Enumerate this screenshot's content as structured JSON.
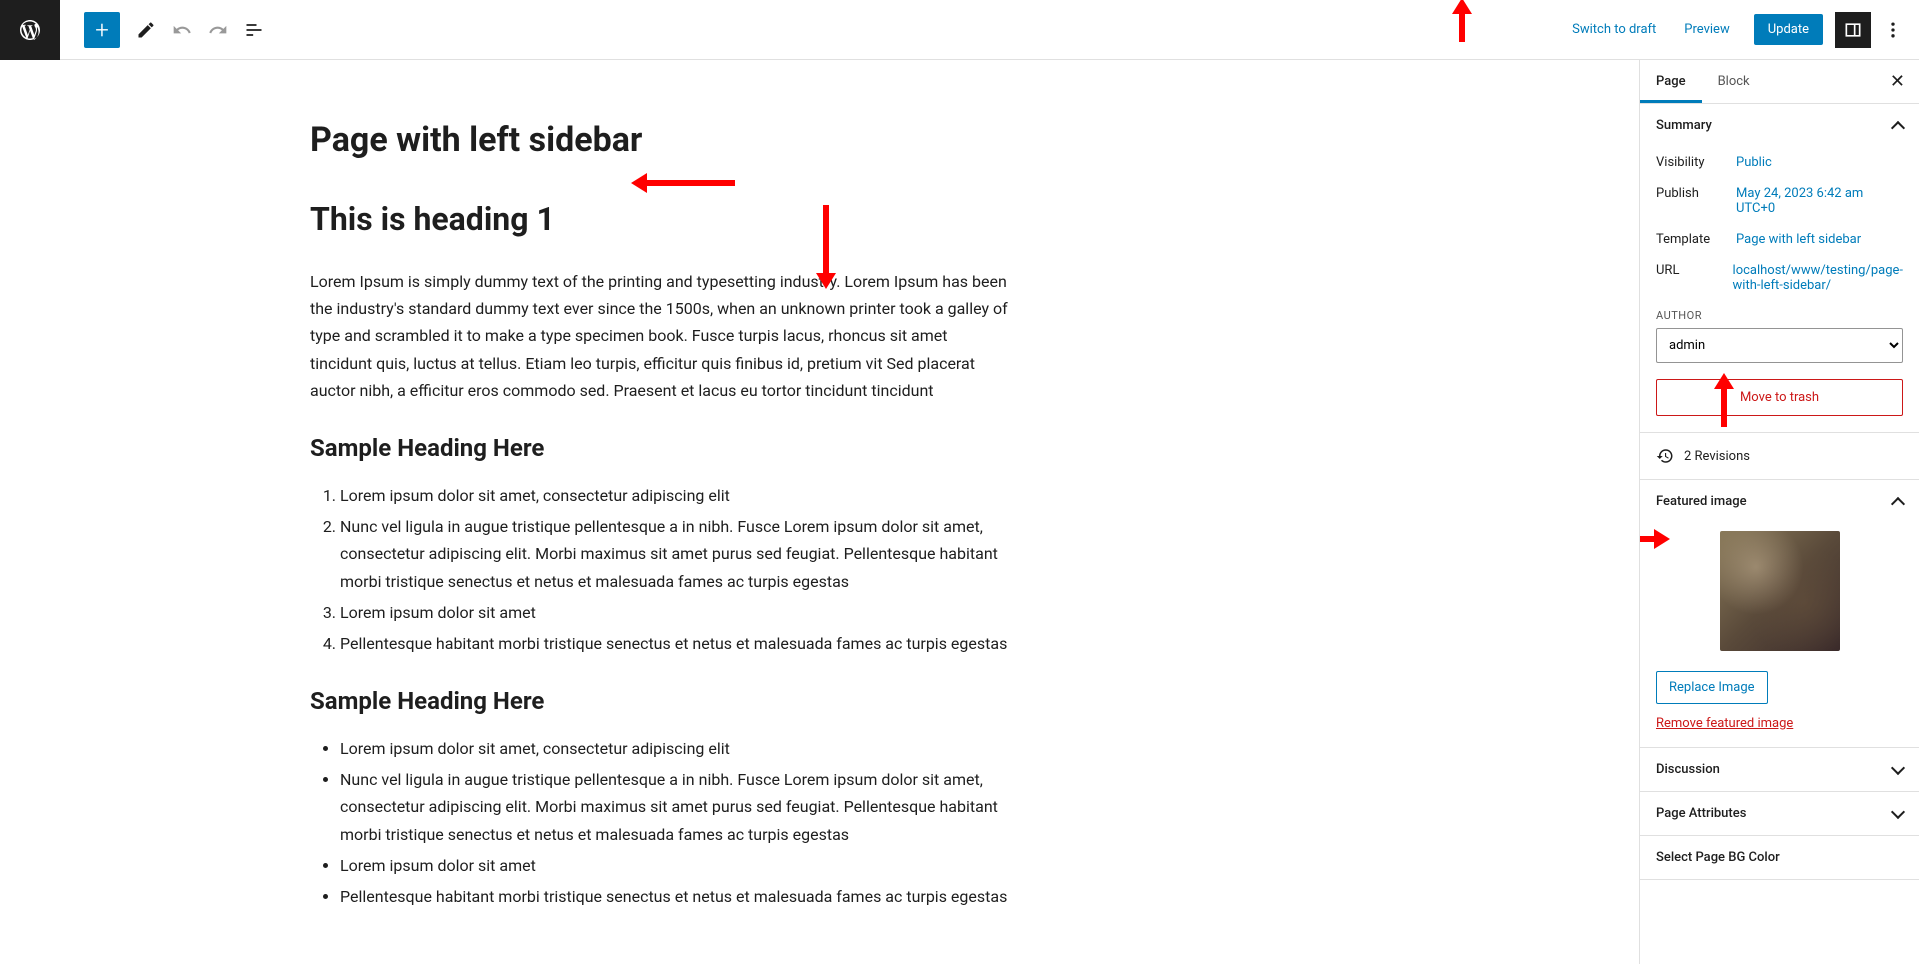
{
  "toolbar": {
    "switch_draft": "Switch to draft",
    "preview": "Preview",
    "update": "Update"
  },
  "editor": {
    "title": "Page with left sidebar",
    "heading1": "This is heading 1",
    "paragraph1": "Lorem Ipsum is simply dummy text of the printing and typesetting industry. Lorem Ipsum has been the industry's standard dummy text ever since the 1500s, when an unknown printer took a galley of type and scrambled it to make a type specimen book. Fusce turpis lacus, rhoncus sit amet tincidunt quis, luctus at tellus. Etiam leo turpis, efficitur quis finibus id, pretium vit Sed placerat auctor nibh, a efficitur eros commodo sed. Praesent et lacus eu tortor tincidunt tincidunt",
    "heading2a": "Sample Heading Here",
    "ol": [
      "Lorem ipsum dolor sit amet, consectetur adipiscing elit",
      "Nunc vel ligula in augue tristique pellentesque a in nibh. Fusce Lorem ipsum dolor sit amet, consectetur adipiscing elit. Morbi maximus sit amet purus sed feugiat. Pellentesque habitant morbi tristique senectus et netus et malesuada fames ac turpis egestas",
      "Lorem ipsum dolor sit amet",
      "Pellentesque habitant morbi tristique senectus et netus et malesuada fames ac turpis egestas"
    ],
    "heading2b": "Sample Heading Here",
    "ul": [
      "Lorem ipsum dolor sit amet, consectetur adipiscing elit",
      "Nunc vel ligula in augue tristique pellentesque a in nibh. Fusce Lorem ipsum dolor sit amet, consectetur adipiscing elit. Morbi maximus sit amet purus sed feugiat. Pellentesque habitant morbi tristique senectus et netus et malesuada fames ac turpis egestas",
      "Lorem ipsum dolor sit amet",
      "Pellentesque habitant morbi tristique senectus et netus et malesuada fames ac turpis egestas"
    ]
  },
  "sidebar": {
    "tabs": {
      "page": "Page",
      "block": "Block"
    },
    "summary": {
      "title": "Summary",
      "visibility_label": "Visibility",
      "visibility_value": "Public",
      "publish_label": "Publish",
      "publish_value": "May 24, 2023 6:42 am UTC+0",
      "template_label": "Template",
      "template_value": "Page with left sidebar",
      "url_label": "URL",
      "url_value": "localhost/www/testing/page-with-left-sidebar/",
      "author_label": "AUTHOR",
      "author_value": "admin",
      "trash": "Move to trash"
    },
    "revisions": "2 Revisions",
    "featured": {
      "title": "Featured image",
      "replace": "Replace Image",
      "remove": "Remove featured image"
    },
    "discussion": "Discussion",
    "attributes": "Page Attributes",
    "bgcolor": "Select Page BG Color"
  }
}
